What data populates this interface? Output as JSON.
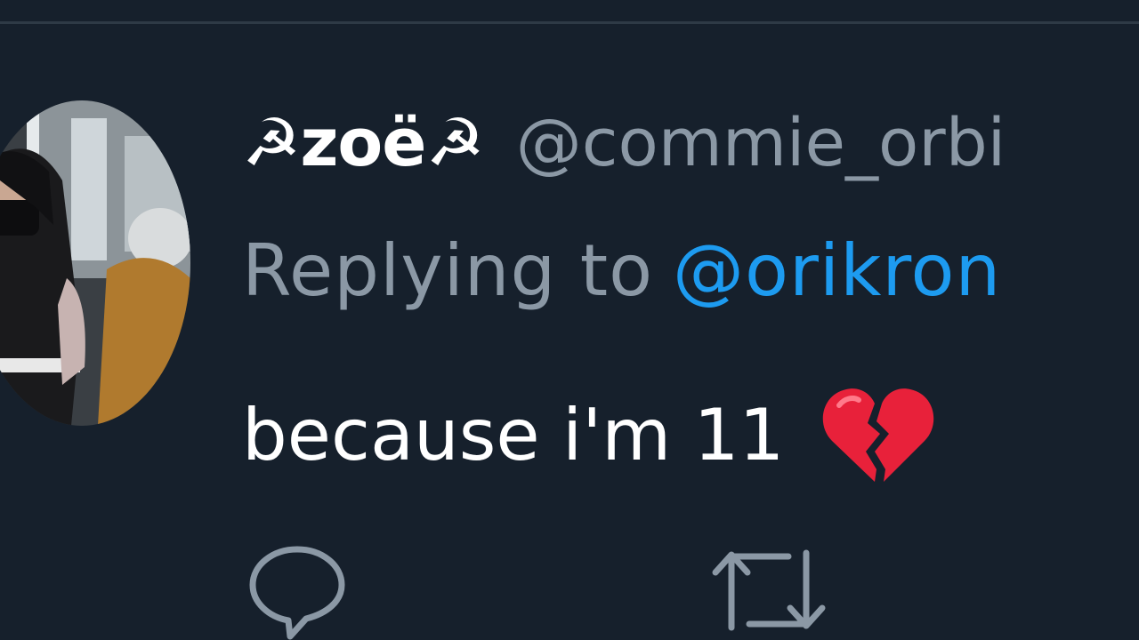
{
  "author": {
    "display_name": "☭zoë☭",
    "handle": "@commie_orbi"
  },
  "reply": {
    "prefix": "Replying to",
    "target": "@orikron"
  },
  "tweet": {
    "text": "because i'm 11",
    "emoji_icon": "broken-heart-icon"
  },
  "actions": {
    "reply_icon": "reply-icon",
    "retweet_icon": "retweet-icon"
  },
  "colors": {
    "background": "#16202c",
    "secondary_text": "#8b98a5",
    "link": "#1d9bf0",
    "emoji_red": "#e8213a"
  }
}
